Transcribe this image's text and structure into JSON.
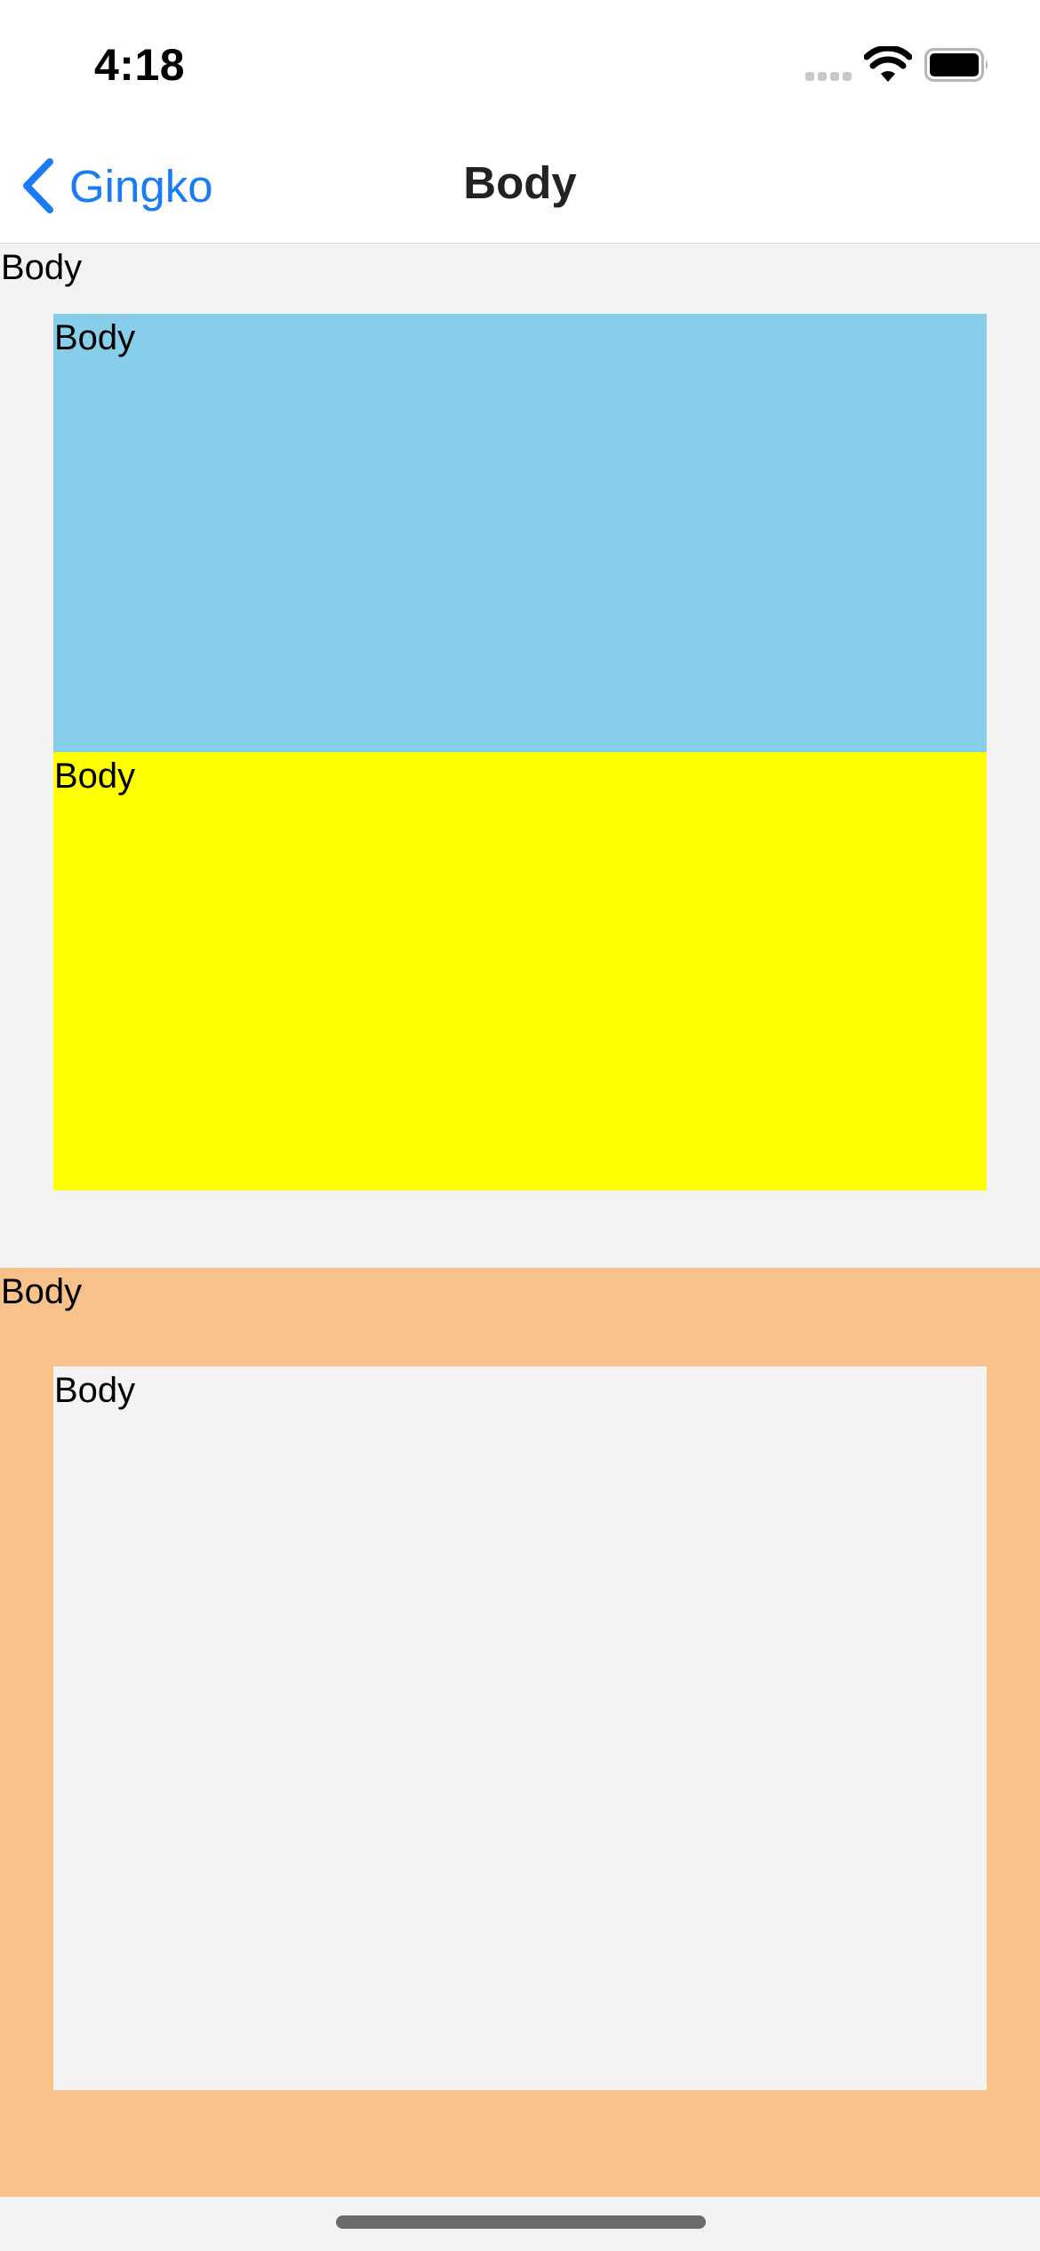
{
  "status_bar": {
    "time": "4:18",
    "signal_icon": "cellular-signal-icon",
    "wifi_icon": "wifi-icon",
    "battery_icon": "battery-icon"
  },
  "nav": {
    "back_label": "Gingko",
    "back_icon": "chevron-left-icon",
    "title": "Body"
  },
  "sections": [
    {
      "label": "Body",
      "color": "#f3f3f3",
      "children": [
        {
          "label": "Body",
          "color": "#87ceeb"
        },
        {
          "label": "Body",
          "color": "#ffff00"
        }
      ]
    },
    {
      "label": "Body",
      "color": "#f8c28a",
      "children": [
        {
          "label": "Body",
          "color": "#f3f3f3"
        }
      ]
    }
  ],
  "colors": {
    "accent": "#1a7cf5",
    "nav_background": "#ffffff",
    "page_background": "#f3f3f3"
  }
}
